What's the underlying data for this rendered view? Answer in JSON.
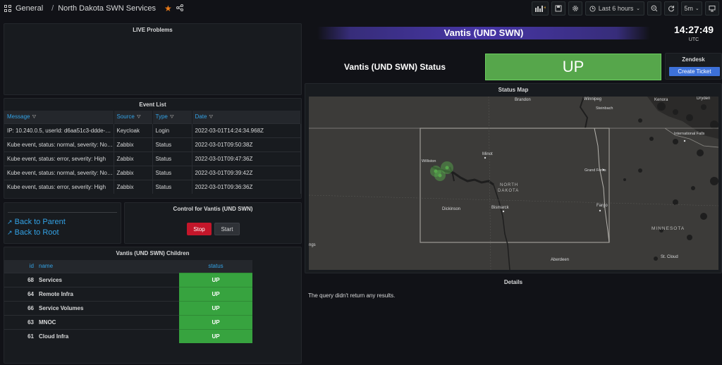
{
  "header": {
    "folder": "General",
    "dashboard_title": "North Dakota SWN Services",
    "time_range": "Last 6 hours",
    "refresh": "5m"
  },
  "live_problems": {
    "title": "LIVE Problems"
  },
  "event_list": {
    "title": "Event List",
    "columns": [
      "Message",
      "Source",
      "Type",
      "Date"
    ],
    "rows": [
      [
        "IP: 10.240.0.5, userId: d6aa51c3-ddde-48...",
        "Keycloak",
        "Login",
        "2022-03-01T14:24:34.968Z"
      ],
      [
        "Kube event, status: normal, severity: Not ...",
        "Zabbix",
        "Status",
        "2022-03-01T09:50:38Z"
      ],
      [
        "Kube event, status: error, severity: High",
        "Zabbix",
        "Status",
        "2022-03-01T09:47:36Z"
      ],
      [
        "Kube event, status: normal, severity: Not ...",
        "Zabbix",
        "Status",
        "2022-03-01T09:39:42Z"
      ],
      [
        "Kube event, status: error, severity: High",
        "Zabbix",
        "Status",
        "2022-03-01T09:36:36Z"
      ]
    ]
  },
  "nav_links": {
    "back_parent": "Back to Parent",
    "back_root": "Back to Root"
  },
  "control": {
    "title": "Control for Vantis (UND SWN)",
    "stop": "Stop",
    "start": "Start"
  },
  "children": {
    "title": "Vantis (UND SWN) Children",
    "columns": [
      "id",
      "name",
      "status"
    ],
    "rows": [
      [
        "68",
        "Services",
        "UP"
      ],
      [
        "64",
        "Remote Infra",
        "UP"
      ],
      [
        "66",
        "Service Volumes",
        "UP"
      ],
      [
        "63",
        "MNOC",
        "UP"
      ],
      [
        "61",
        "Cloud Infra",
        "UP"
      ]
    ]
  },
  "banner": {
    "title": "Vantis (UND SWN)"
  },
  "clock": {
    "time": "14:27:49",
    "tz": "UTC"
  },
  "status": {
    "label": "Vantis (UND SWN) Status",
    "value": "UP"
  },
  "zendesk": {
    "title": "Zendesk",
    "button": "Create Ticket"
  },
  "status_map": {
    "title": "Status Map",
    "labels": {
      "brandon": "Brandon",
      "winnipeg": "Winnipeg",
      "steinbach": "Steinbach",
      "kenora": "Kenora",
      "dryden": "Dryden",
      "intl_falls": "International Falls",
      "williston": "Williston",
      "minot": "Minot",
      "grand_forks": "Grand Forks",
      "north": "NORTH",
      "dakota": "DAKOTA",
      "dickinson": "Dickinson",
      "bismarck": "Bismarck",
      "fargo": "Fargo",
      "minnesota": "MINNESOTA",
      "st_cloud": "St. Cloud",
      "aberdeen": "Aberdeen",
      "ngs": "ngs"
    },
    "marker_status": "UP",
    "colors": {
      "marker": "#56a64b",
      "land": "#3c3b39",
      "water": "#1e1e1e"
    }
  },
  "details": {
    "title": "Details",
    "message": "The query didn't return any results."
  }
}
